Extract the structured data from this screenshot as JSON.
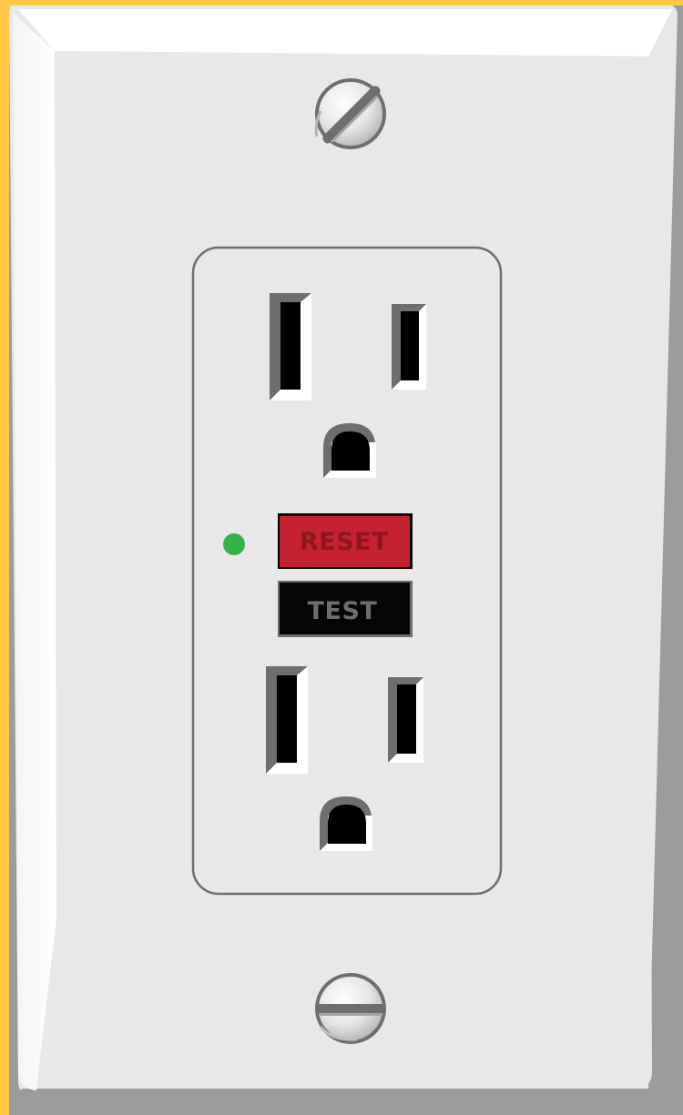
{
  "outlet": {
    "reset_label": "RESET",
    "test_label": "TEST",
    "indicator_state": "on",
    "top_screw": "screw-head-icon",
    "bottom_screw": "screw-head-icon"
  },
  "colors": {
    "background": "#FFC843",
    "plate": "#E8E8E8",
    "plate_edge": "#9A9C9E",
    "reset_button": "#C4222F",
    "reset_text": "#8E1620",
    "test_button": "#050505",
    "test_text": "#6E6E6E",
    "indicator": "#34B34A",
    "slot": "#000000"
  }
}
